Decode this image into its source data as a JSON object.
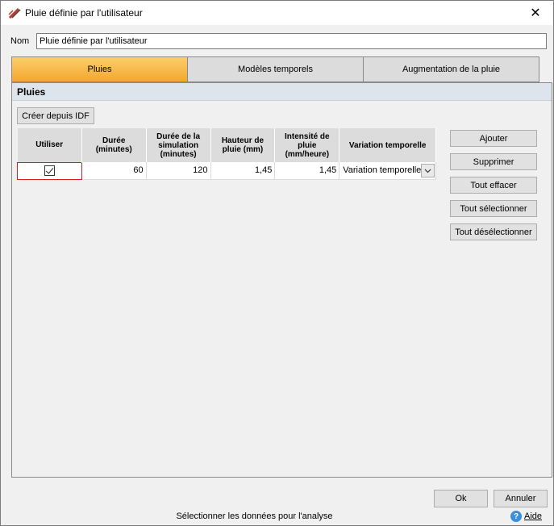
{
  "window": {
    "title": "Pluie définie par l'utilisateur",
    "close_label": "✕"
  },
  "name_field": {
    "label": "Nom",
    "value": "Pluie définie par l'utilisateur"
  },
  "tabs": [
    {
      "label": "Pluies",
      "active": true
    },
    {
      "label": "Modèles temporels",
      "active": false
    },
    {
      "label": "Augmentation de la pluie",
      "active": false
    }
  ],
  "section": {
    "title": "Pluies",
    "idf_button": "Créer depuis IDF"
  },
  "table": {
    "headers": {
      "use": "Utiliser",
      "duration": "Durée (minutes)",
      "sim_duration": "Durée de la simulation (minutes)",
      "height": "Hauteur de pluie (mm)",
      "intensity": "Intensité de pluie (mm/heure)",
      "variation": "Variation temporelle"
    },
    "rows": [
      {
        "use": true,
        "duration": "60",
        "sim_duration": "120",
        "height": "1,45",
        "intensity": "1,45",
        "variation": "Variation temporelle"
      }
    ]
  },
  "side_buttons": {
    "add": "Ajouter",
    "delete": "Supprimer",
    "clear_all": "Tout effacer",
    "select_all": "Tout sélectionner",
    "deselect_all": "Tout désélectionner"
  },
  "footer": {
    "ok": "Ok",
    "cancel": "Annuler",
    "status": "Sélectionner les données pour l'analyse",
    "help": "Aide"
  },
  "colors": {
    "active_tab": "#f3a630",
    "section_header": "#dde4ec",
    "selected_cell_border": "#d61c1c"
  }
}
